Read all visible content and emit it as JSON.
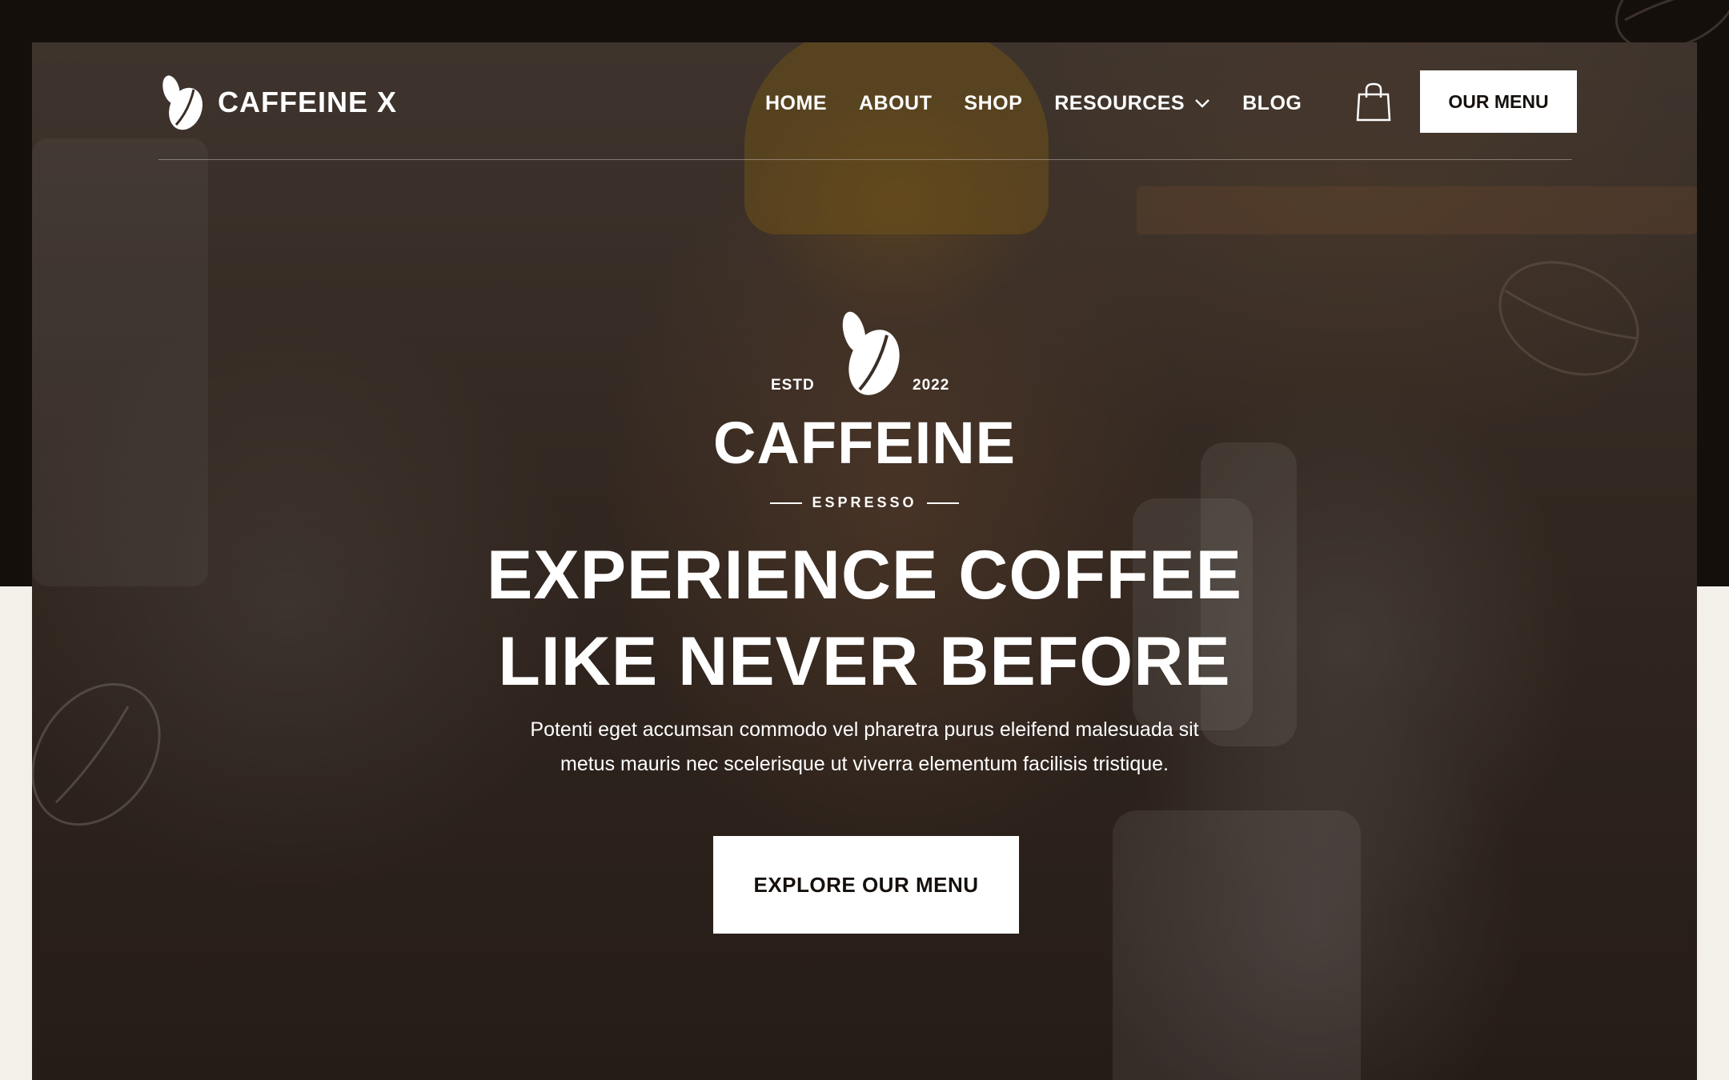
{
  "brand": {
    "logo_text": "CAFFEINE X",
    "logo_icon": "coffee-bean-icon"
  },
  "nav": {
    "items": [
      {
        "label": "HOME"
      },
      {
        "label": "ABOUT"
      },
      {
        "label": "SHOP"
      },
      {
        "label": "RESOURCES",
        "has_dropdown": true
      },
      {
        "label": "BLOG"
      }
    ],
    "cart_icon": "shopping-bag-icon",
    "menu_button": "OUR MENU"
  },
  "badge": {
    "estd": "ESTD",
    "year": "2022",
    "name": "CAFFEINE",
    "subtitle": "ESPRESSO"
  },
  "hero": {
    "headline_line1": "EXPERIENCE COFFEE",
    "headline_line2": "LIKE NEVER BEFORE",
    "description_line1": "Potenti eget accumsan commodo vel pharetra purus eleifend malesuada sit",
    "description_line2": "metus mauris nec scelerisque ut viverra elementum facilisis tristique.",
    "cta_label": "EXPLORE OUR MENU"
  },
  "colors": {
    "dark_band": "#150f0c",
    "page_background": "#f3efe9",
    "button_background": "#ffffff",
    "button_text": "#15100c",
    "text": "#ffffff"
  }
}
